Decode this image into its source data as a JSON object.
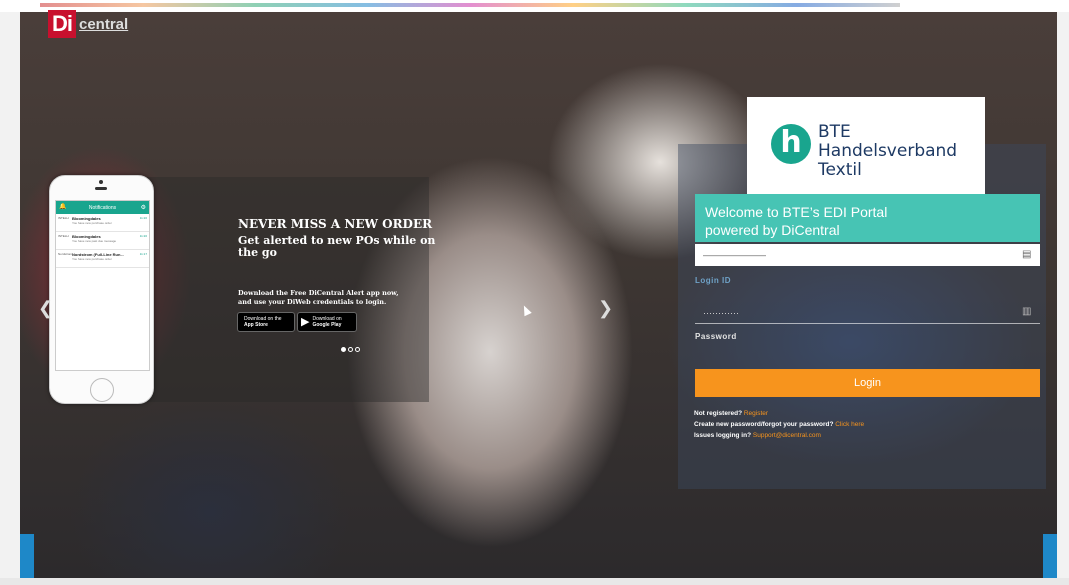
{
  "brand": {
    "di": "Di",
    "central": "central"
  },
  "carousel": {
    "headline": "NEVER MISS A NEW ORDER",
    "subhead": "Get alerted to new POs while on the go",
    "download_text": "Download the Free DiCentral Alert app now, and use your DiWeb credentials to login.",
    "appstore_line1": "Download on the",
    "appstore_line2": "App Store",
    "googleplay_line1": "Download on",
    "googleplay_line2": "Google Play",
    "prev_icon": "chevron-left-icon",
    "next_icon": "chevron-right-icon"
  },
  "phone": {
    "title": "Notifications",
    "items": [
      {
        "tag": "INTELLI",
        "name": "Bloomingdales",
        "sub": "You have new purchase order",
        "time": "11:20"
      },
      {
        "tag": "INTELLI",
        "name": "Bloomingdales",
        "sub": "You have new past due message",
        "time": "11:20"
      },
      {
        "tag": "Nordstrom",
        "name": "Nordstrom (Full-Line Run...",
        "sub": "You have new purchase order",
        "time": "11:17"
      }
    ]
  },
  "partner": {
    "mark": "h",
    "line1": "BTE",
    "line2": "Handelsverband",
    "line3": "Textil"
  },
  "login": {
    "welcome_line1": "Welcome to BTE’s EDI Portal",
    "welcome_line2": "powered by DiCentral",
    "username_value": "———————",
    "username_label": "Login ID",
    "password_value": "············",
    "password_label": "Password",
    "login_button": "Login",
    "not_registered": "Not registered?",
    "register_link": "Register",
    "forgot_text": "Create new password/forgot your password?",
    "click_here": "Click here",
    "issues_text": "Issues logging in?",
    "support_email": "Support@dicentral.com"
  },
  "colors": {
    "teal": "#47c4b4",
    "orange": "#f7941d",
    "brand_red": "#c8102e",
    "navy": "#1e3a64"
  }
}
